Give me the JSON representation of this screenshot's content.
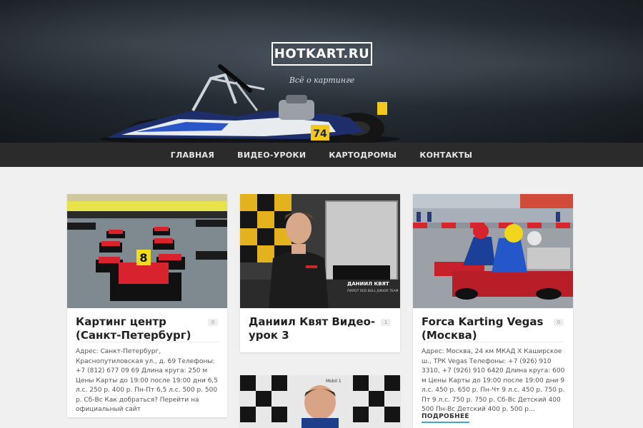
{
  "site": {
    "logo": "HOTKART.RU",
    "tagline": "Всё о картинге"
  },
  "nav": [
    {
      "label": "Главная"
    },
    {
      "label": "Видео-уроки"
    },
    {
      "label": "Картодромы"
    },
    {
      "label": "Контакты"
    }
  ],
  "posts": [
    {
      "title": "Картинг центр (Санкт-Петербург)",
      "comments": "0",
      "excerpt": "Адрес: Санкт-Петербург, Краснопутиловская ул., д. 69 Телефоны: +7 (812) 677 09 69 Длина круга: 250 м Цены Карты до 19:00 после 19:00 дни 6,5 л.с. 250 р. 400 р. Пн-Пт 6,5 л.с. 500 р. 500 р. Сб-Вс Как добраться? Перейти на официальный сайт"
    },
    {
      "title": "Даниил Квят Видео-урок 3",
      "comments": "1",
      "caption_name": "ДАНИИЛ КВЯТ",
      "caption_sub": "ПИЛОТ RED BULL JUNIOR TEAM"
    },
    {
      "title": "Forca Karting Vegas (Москва)",
      "comments": "0",
      "excerpt": "Адрес: Москва, 24 км МКАД Х Каширское ш., ТРК Vegas Телефоны: +7 (926) 910 3310, +7 (926) 910 6420 Длина круга: 600 м Цены Карты до 19:00 после 19:00 дни 9 л.с. 450 р. 650 р. Пн-Чт 9 л.с. 450 р. 750 р. Пт 9 л.с. 750 р. 750 р. Сб-Вс Детский 400 500 Пн-Вс Детский 400 р. 500 р…",
      "more": "Подробнее"
    },
    {
      "banner_text": "Mobil 1"
    }
  ],
  "colors": {
    "nav_bg": "#2b2b2b",
    "accent": "#3fa7d6",
    "page_bg": "#f0f0f0"
  }
}
